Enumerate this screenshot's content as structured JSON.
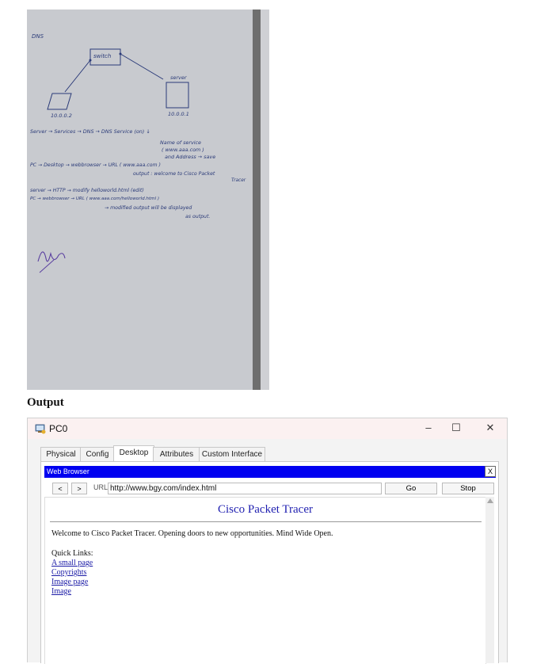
{
  "notebook_photo": {
    "heading": "DNS",
    "diagram": {
      "switch_label": "switch",
      "server_label": "server",
      "pc_ip": "10.0.0.2",
      "server_ip": "10.0.0.1"
    },
    "lines": [
      "Server → Services → DNS → DNS Service (on) ↓",
      "Name of service",
      "( www.aaa.com )",
      "and Address → save",
      "PC → Desktop → webbrowser → URL ( www.aaa.com )",
      "output : welcome to Cisco Packet",
      "Tracer",
      "server → HTTP → modify helloworld.html (edit)",
      "PC → webbrowser → URL ( www.aaa.com/helloworld.html )",
      "→ modified output will be displayed",
      "as output."
    ],
    "signature": "Ali 17/10/24"
  },
  "output_heading": "Output",
  "window": {
    "title": "PC0",
    "controls": {
      "minimize": "–",
      "maximize": "☐",
      "close": "✕"
    },
    "tabs": [
      "Physical",
      "Config",
      "Desktop",
      "Attributes",
      "Custom Interface"
    ],
    "active_tab": "Desktop",
    "browser": {
      "bar_title": "Web Browser",
      "close_label": "X",
      "back_label": "<",
      "forward_label": ">",
      "url_label": "URL",
      "url_value": "http://www.bgy.com/index.html",
      "go_label": "Go",
      "stop_label": "Stop",
      "page": {
        "title": "Cisco Packet Tracer",
        "welcome": "Welcome to Cisco Packet Tracer. Opening doors to new opportunities. Mind Wide Open.",
        "quick_links_label": "Quick Links:",
        "links": [
          "A small page",
          "Copyrights",
          "Image page",
          "Image"
        ]
      }
    }
  }
}
